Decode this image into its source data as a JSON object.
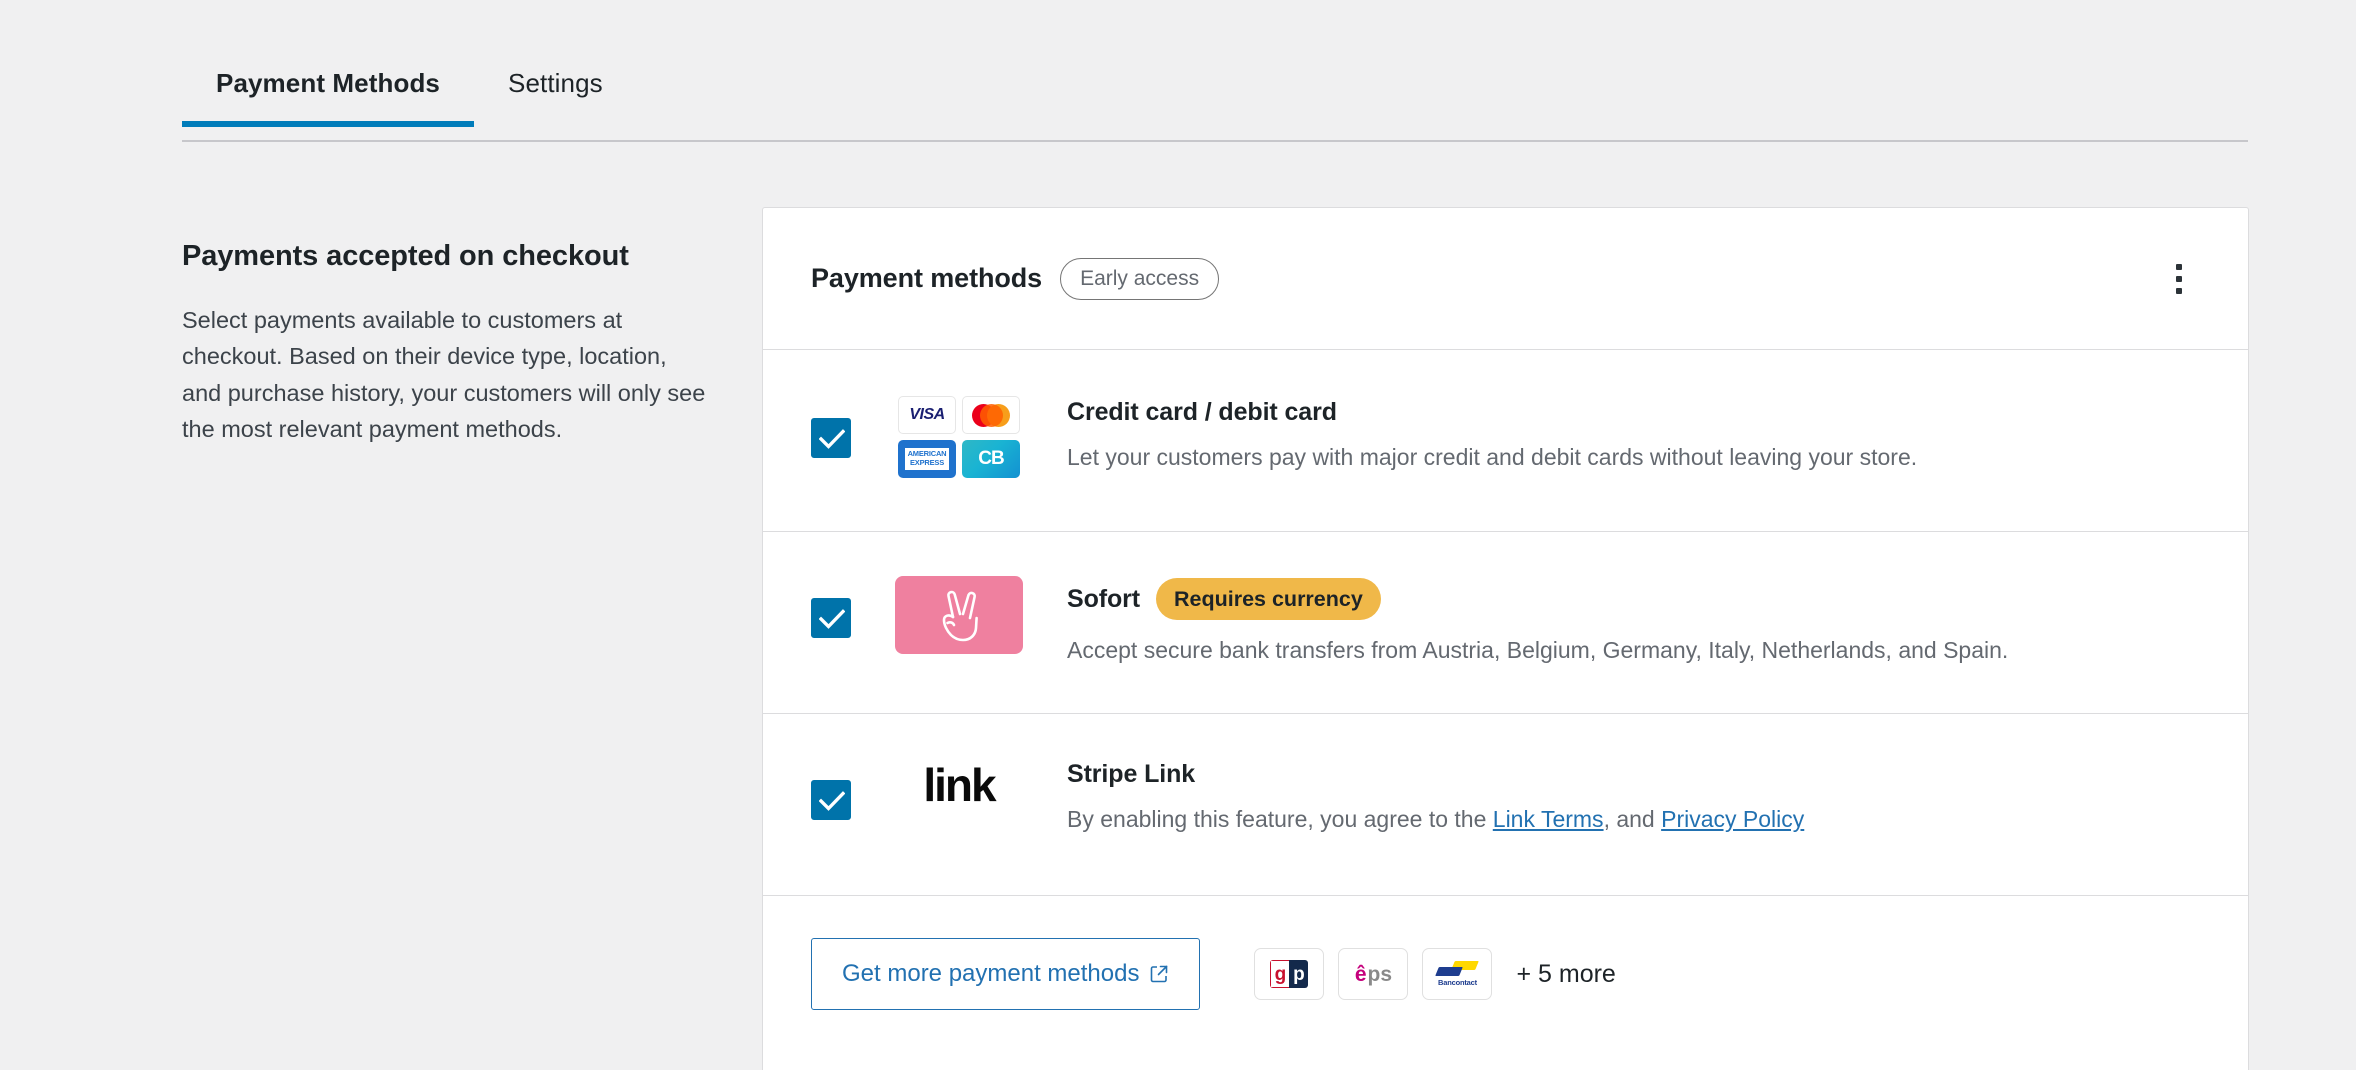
{
  "tabs": [
    {
      "label": "Payment Methods",
      "active": true
    },
    {
      "label": "Settings",
      "active": false
    }
  ],
  "left_panel": {
    "heading": "Payments accepted on checkout",
    "description": "Select payments available to customers at checkout. Based on their device type, location, and purchase history, your customers will only see the most relevant payment methods."
  },
  "card": {
    "title": "Payment methods",
    "title_badge": "Early access",
    "menu_icon": "kebab-menu-icon",
    "methods": [
      {
        "id": "credit-card",
        "checked": true,
        "title": "Credit card / debit card",
        "badge": null,
        "description": "Let your customers pay with major credit and debit cards without leaving your store.",
        "logos": [
          "visa",
          "mastercard",
          "amex",
          "cartes-bancaires"
        ],
        "logo_labels": {
          "visa": "VISA",
          "amex_line1": "AMERICAN",
          "amex_line2": "EXPRESS",
          "cb": "CB"
        }
      },
      {
        "id": "sofort",
        "checked": true,
        "title": "Sofort",
        "badge": "Requires currency",
        "description": "Accept secure bank transfers from Austria, Belgium, Germany, Italy, Netherlands, and Spain.",
        "logos": [
          "sofort"
        ]
      },
      {
        "id": "stripe-link",
        "checked": true,
        "title": "Stripe Link",
        "badge": null,
        "description_parts": [
          {
            "text": "By enabling this feature, you agree to the ",
            "link": false
          },
          {
            "text": "Link Terms",
            "link": true
          },
          {
            "text": ", and ",
            "link": false
          },
          {
            "text": "Privacy Policy",
            "link": true
          }
        ],
        "logos": [
          "link"
        ],
        "logo_labels": {
          "link": "link"
        }
      }
    ],
    "footer": {
      "button_label": "Get more payment methods",
      "button_icon": "external-link-icon",
      "logos": [
        {
          "id": "giropay",
          "g": "g",
          "p": "p"
        },
        {
          "id": "eps",
          "e": "ê",
          "ps": "ps"
        },
        {
          "id": "bancontact",
          "label": "Bancontact"
        }
      ],
      "more_label": "+ 5 more"
    }
  },
  "colors": {
    "page_background": "#f0f0f1",
    "accent_blue": "#007cba",
    "link_blue": "#2271b1",
    "checkbox_blue": "#0073aa",
    "warning_amber": "#f0b849",
    "sofort_pink": "#ef809f",
    "card_border": "#dcdcde",
    "text_primary": "#1d2327",
    "text_secondary": "#646970"
  }
}
